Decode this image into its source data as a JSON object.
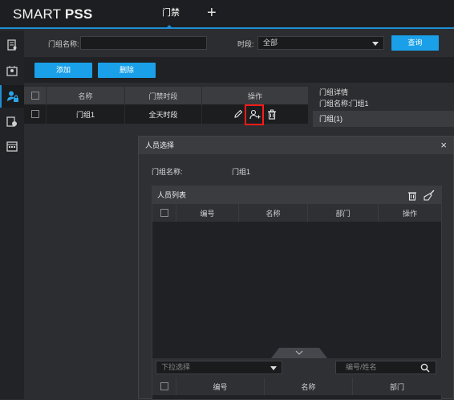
{
  "app": {
    "logo_light": "SMART ",
    "logo_bold": "PSS",
    "active_tab": "门禁",
    "add_tab": "+"
  },
  "sidebar": {
    "icons": [
      "device-icon",
      "door-icon",
      "person-lock-icon",
      "record-icon",
      "schedule-icon"
    ]
  },
  "filter": {
    "group_name_label": "门组名称:",
    "group_name_value": "",
    "period_label": "时段:",
    "period_value": "全部",
    "query_button": "查询"
  },
  "actions": {
    "add_button": "添加",
    "delete_button": "删除"
  },
  "table": {
    "headers": [
      "名称",
      "门禁时段",
      "操作"
    ],
    "rows": [
      {
        "name": "门组1",
        "period": "全天时段"
      }
    ]
  },
  "detail": {
    "title": "门组详情",
    "group_name": "门组名称:门组1",
    "selected": "门组(1)"
  },
  "dialog": {
    "title": "人员选择",
    "close": "×",
    "group_name_label": "门组名称:",
    "group_name_value": "门组1",
    "list_title": "人员列表",
    "list_headers": [
      "编号",
      "名称",
      "部门",
      "操作"
    ],
    "dropdown_placeholder": "下拉选择",
    "search_placeholder": "编号/姓名",
    "bottom_headers": [
      "编号",
      "名称",
      "部门"
    ]
  },
  "colors": {
    "accent": "#1aa0e8",
    "highlight": "#ff1a1a"
  }
}
